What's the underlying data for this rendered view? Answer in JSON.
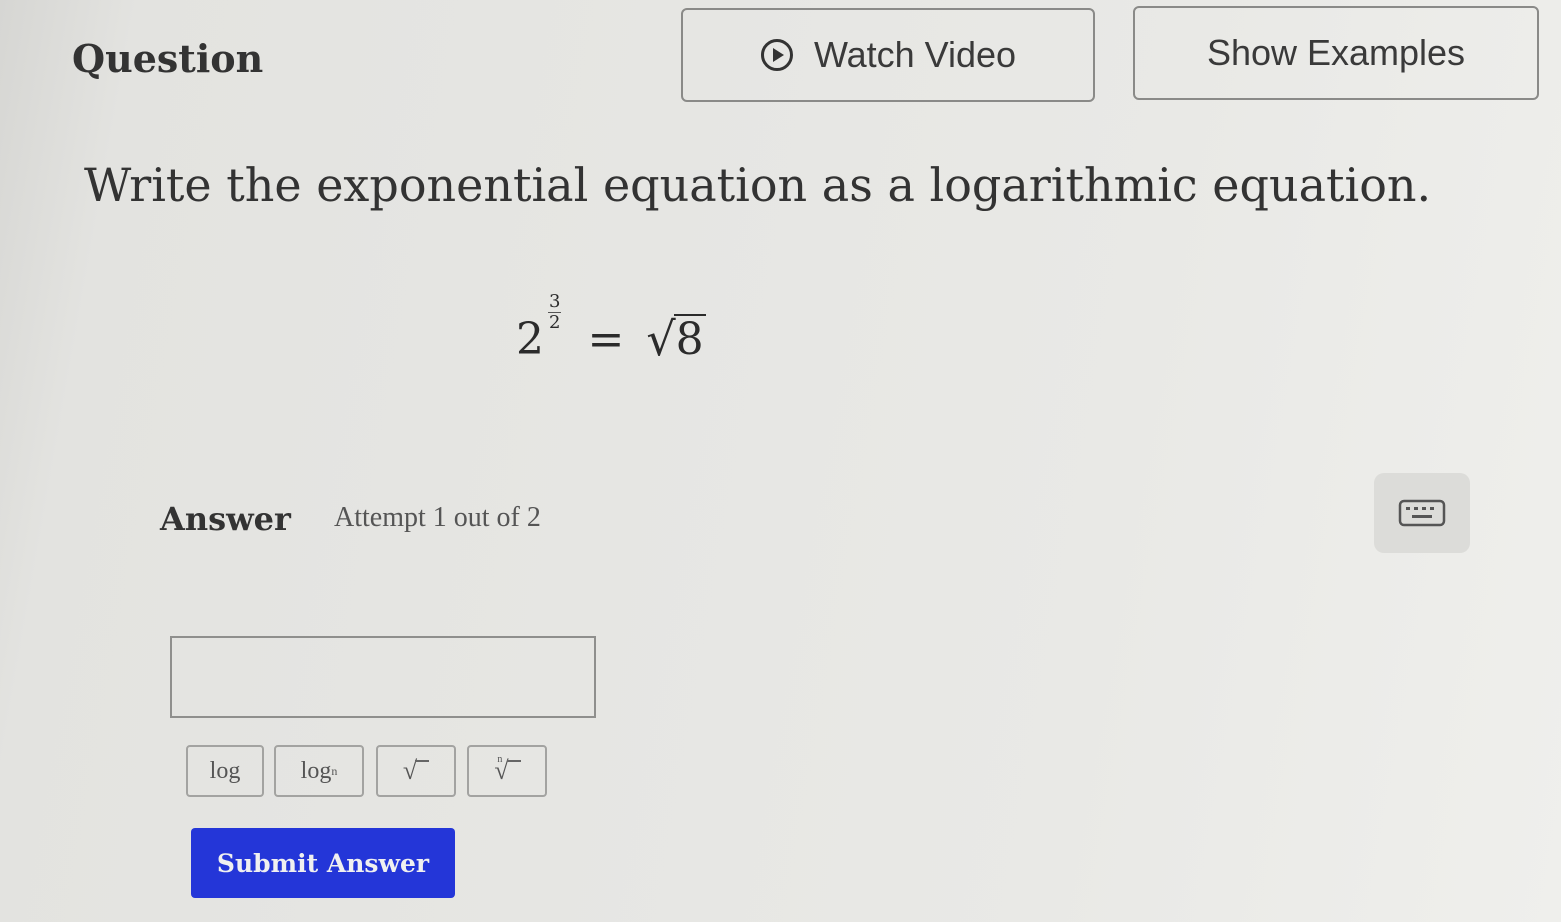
{
  "header": {
    "question_label": "Question",
    "watch_video_label": "Watch Video",
    "show_examples_label": "Show Examples"
  },
  "question": {
    "prompt": "Write the exponential equation as a logarithmic equation.",
    "equation": {
      "base": "2",
      "exponent_numerator": "3",
      "exponent_denominator": "2",
      "equals": "=",
      "radical_sign": "√",
      "radicand": "8"
    }
  },
  "answer": {
    "label": "Answer",
    "attempt_text": "Attempt 1 out of 2",
    "input_value": "",
    "tools": {
      "log_label": "log",
      "logn_label": "log",
      "logn_subscript": "n",
      "sqrt_label": "√",
      "nroot_label": "√",
      "nroot_index": "n"
    },
    "submit_label": "Submit Answer"
  },
  "icons": {
    "play": "play-circle-icon",
    "keyboard": "keyboard-icon"
  },
  "colors": {
    "submit_button": "#2436d8",
    "background": "#e6e6e3"
  }
}
